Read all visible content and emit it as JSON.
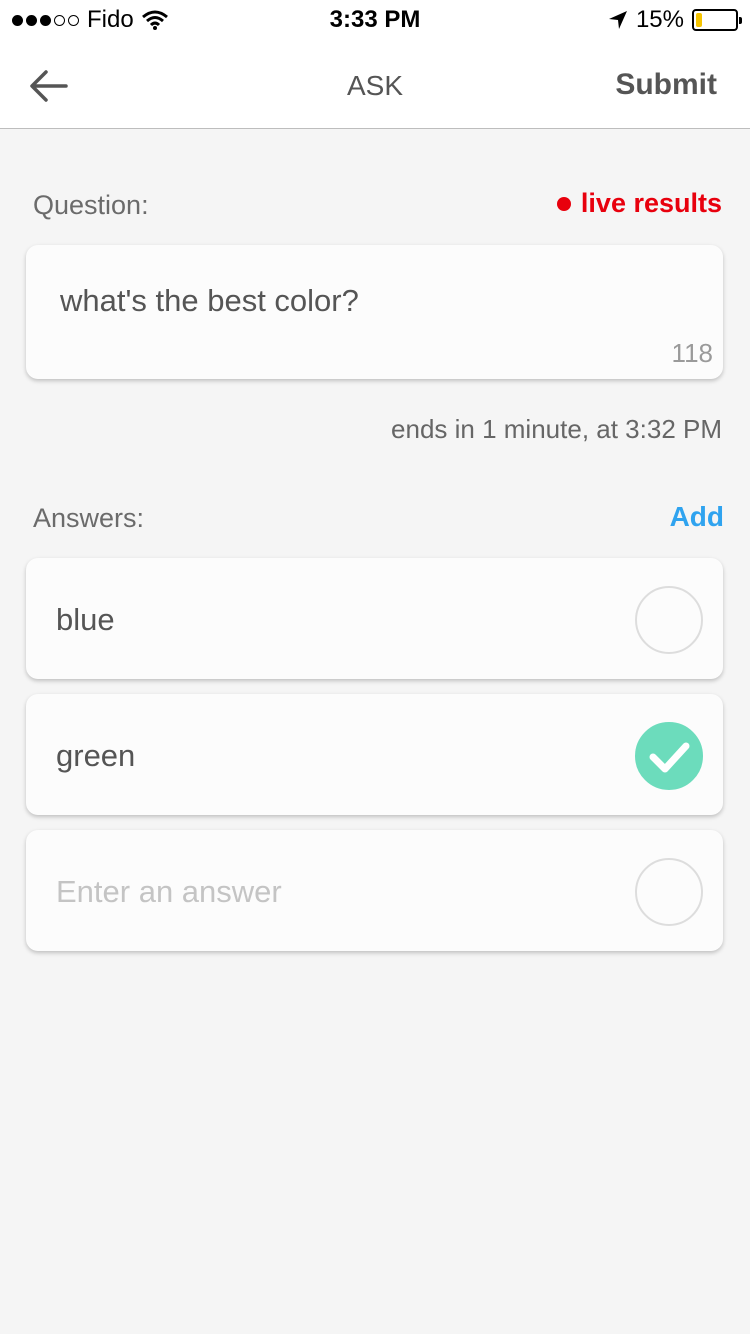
{
  "status_bar": {
    "carrier": "Fido",
    "time": "3:33 PM",
    "battery_percent": "15%",
    "battery_level": 0.15,
    "signal_bars_filled": 3,
    "signal_bars_total": 5
  },
  "nav": {
    "back_icon": "arrow-left-icon",
    "title": "ASK",
    "submit_label": "Submit"
  },
  "question": {
    "label": "Question:",
    "live_label": "live results",
    "text": "what's the best color?",
    "char_count": "118",
    "ends_text": "ends in 1 minute, at 3:32 PM"
  },
  "answers": {
    "label": "Answers:",
    "add_label": "Add",
    "items": [
      {
        "text": "blue",
        "checked": false
      },
      {
        "text": "green",
        "checked": true
      }
    ],
    "new_placeholder": "Enter an answer"
  },
  "colors": {
    "accent_blue": "#2fa3ef",
    "live_red": "#e8000d",
    "check_green": "#6cdcbc",
    "background": "#f5f5f5"
  }
}
